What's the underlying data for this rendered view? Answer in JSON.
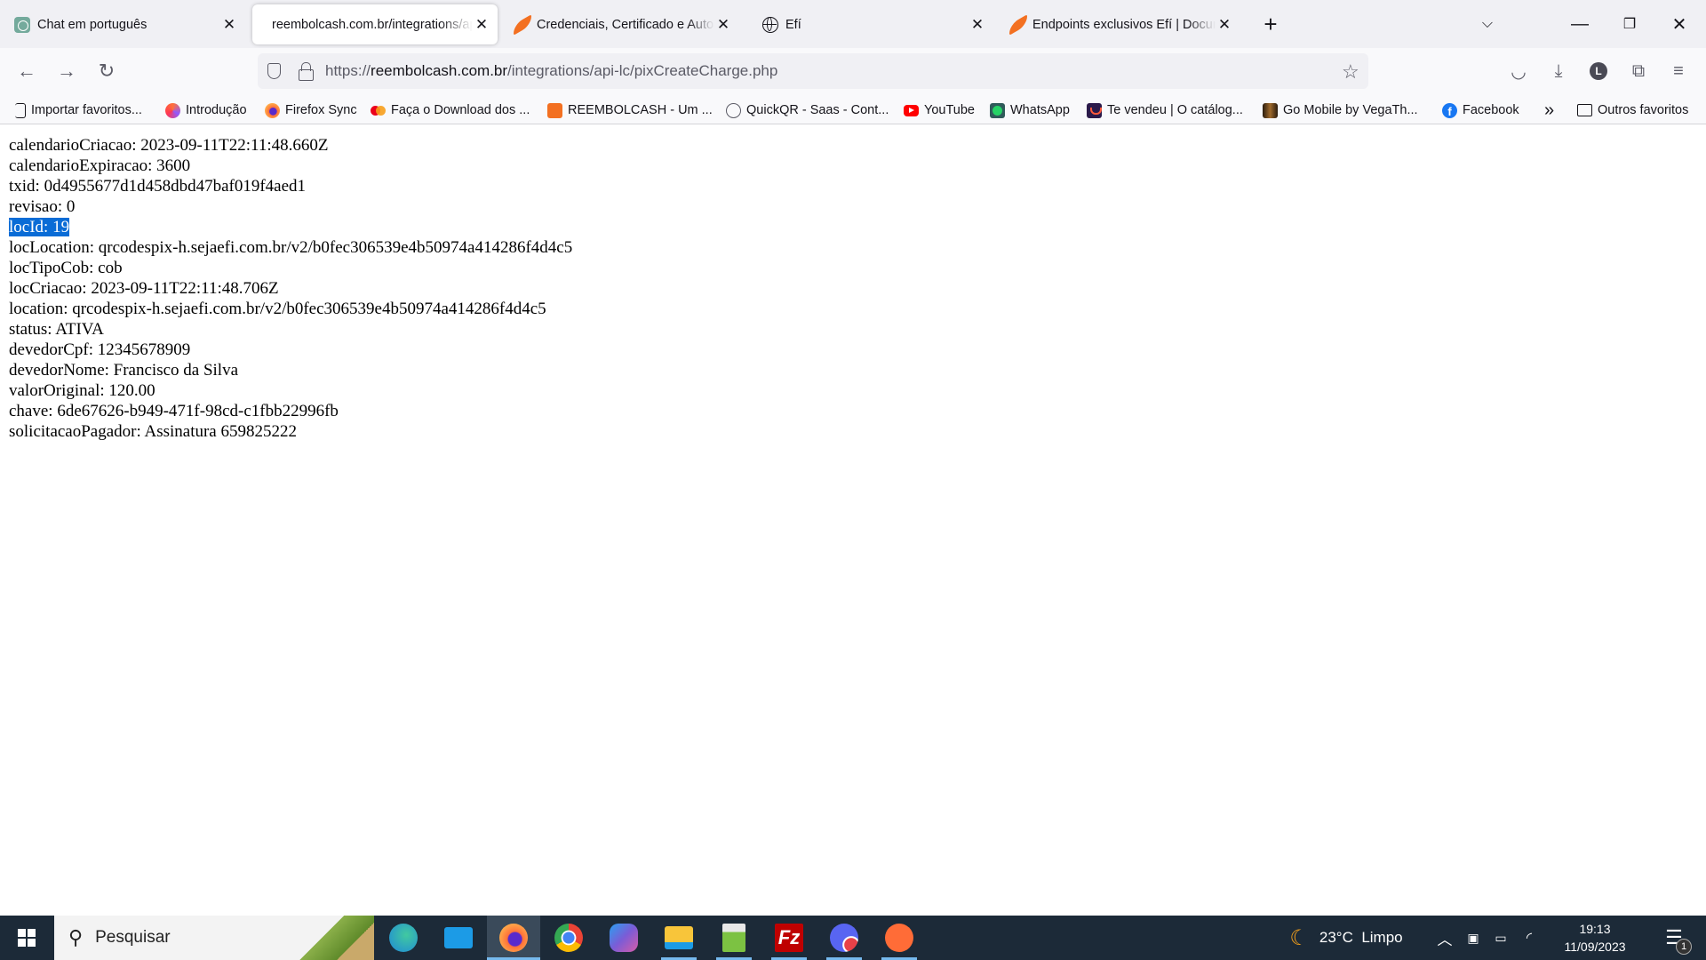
{
  "browser": {
    "tabs": [
      {
        "title": "Chat em português",
        "favicon": "chatgpt-icon",
        "active": false
      },
      {
        "title": "reembolcash.com.br/integrations/api-lc/pixCreateCharge.php",
        "favicon": "none",
        "active": true
      },
      {
        "title": "Credenciais, Certificado e Autorização",
        "favicon": "efi-icon",
        "active": false
      },
      {
        "title": "Efí",
        "favicon": "globe-icon",
        "active": false
      },
      {
        "title": "Endpoints exclusivos Efí | Documentação",
        "favicon": "efi-icon",
        "active": false
      }
    ],
    "new_tab_label": "+",
    "url": {
      "scheme": "https://",
      "host": "reembolcash.com.br",
      "path": "/integrations/api-lc/pixCreateCharge.php"
    },
    "profile_initial": "L",
    "bookmarks": [
      {
        "label": "Importar favoritos...",
        "icon": "import-icon"
      },
      {
        "label": "Introdução",
        "icon": "firefox-intro-icon"
      },
      {
        "label": "Firefox Sync",
        "icon": "firefox-icon"
      },
      {
        "label": "Faça o Download dos ...",
        "icon": "mastercard-icon"
      },
      {
        "label": "REEMBOLCASH - Um ...",
        "icon": "reembolcash-icon"
      },
      {
        "label": "QuickQR - Saas - Cont...",
        "icon": "globe-icon"
      },
      {
        "label": "YouTube",
        "icon": "youtube-icon"
      },
      {
        "label": "WhatsApp",
        "icon": "whatsapp-icon"
      },
      {
        "label": "Te vendeu | O catálog...",
        "icon": "tevendeu-icon"
      },
      {
        "label": "Go Mobile by VegaTh...",
        "icon": "gomobile-icon"
      },
      {
        "label": "Facebook",
        "icon": "facebook-icon"
      }
    ],
    "overflow_label": "»",
    "other_bookmarks_label": "Outros favoritos"
  },
  "page": {
    "lines": [
      {
        "key": "calendarioCriacao",
        "value": "2023-09-11T22:11:48.660Z",
        "text": "calendarioCriacao: 2023-09-11T22:11:48.660Z"
      },
      {
        "key": "calendarioExpiracao",
        "value": "3600",
        "text": "calendarioExpiracao: 3600"
      },
      {
        "key": "txid",
        "value": "0d4955677d1d458dbd47baf019f4aed1",
        "text": "txid: 0d4955677d1d458dbd47baf019f4aed1"
      },
      {
        "key": "revisao",
        "value": "0",
        "text": "revisao: 0"
      },
      {
        "key": "locId",
        "value": "19",
        "text": "locId: 19",
        "selected": true
      },
      {
        "key": "locLocation",
        "value": "qrcodespix-h.sejaefi.com.br/v2/b0fec306539e4b50974a414286f4d4c5",
        "text": "locLocation: qrcodespix-h.sejaefi.com.br/v2/b0fec306539e4b50974a414286f4d4c5"
      },
      {
        "key": "locTipoCob",
        "value": "cob",
        "text": "locTipoCob: cob"
      },
      {
        "key": "locCriacao",
        "value": "2023-09-11T22:11:48.706Z",
        "text": "locCriacao: 2023-09-11T22:11:48.706Z"
      },
      {
        "key": "location",
        "value": "qrcodespix-h.sejaefi.com.br/v2/b0fec306539e4b50974a414286f4d4c5",
        "text": "location: qrcodespix-h.sejaefi.com.br/v2/b0fec306539e4b50974a414286f4d4c5"
      },
      {
        "key": "status",
        "value": "ATIVA",
        "text": "status: ATIVA"
      },
      {
        "key": "devedorCpf",
        "value": "12345678909",
        "text": "devedorCpf: 12345678909"
      },
      {
        "key": "devedorNome",
        "value": "Francisco da Silva",
        "text": "devedorNome: Francisco da Silva"
      },
      {
        "key": "valorOriginal",
        "value": "120.00",
        "text": "valorOriginal: 120.00"
      },
      {
        "key": "chave",
        "value": "6de67626-b949-471f-98cd-c1fbb22996fb",
        "text": "chave: 6de67626-b949-471f-98cd-c1fbb22996fb"
      },
      {
        "key": "solicitacaoPagador",
        "value": "Assinatura 659825222",
        "text": "solicitacaoPagador: Assinatura 659825222"
      }
    ]
  },
  "taskbar": {
    "search_placeholder": "Pesquisar",
    "apps": [
      {
        "name": "edge-can",
        "color": "#1e88d8",
        "running": false
      },
      {
        "name": "mail",
        "color": "#1c9be6",
        "running": false
      },
      {
        "name": "firefox",
        "color": "#ff7139",
        "running": true,
        "active": true
      },
      {
        "name": "chrome",
        "color": "#34a853",
        "running": false
      },
      {
        "name": "copilot",
        "color": "#7b5cd6",
        "running": false
      },
      {
        "name": "file-explorer",
        "color": "#f8c53a",
        "running": true
      },
      {
        "name": "notepad-plus-plus",
        "color": "#7cc242",
        "running": true
      },
      {
        "name": "filezilla",
        "color": "#bf0000",
        "running": true
      },
      {
        "name": "discord",
        "color": "#5865f2",
        "running": true
      },
      {
        "name": "postman",
        "color": "#ff6c37",
        "running": true
      }
    ],
    "weather": {
      "temp": "23°C",
      "condition": "Limpo"
    },
    "time": "19:13",
    "date": "11/09/2023",
    "notification_count": "1"
  }
}
